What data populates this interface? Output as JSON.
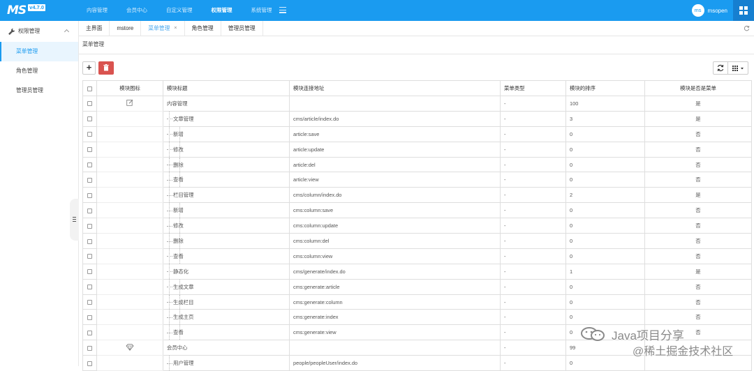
{
  "app": {
    "logo": "MS",
    "version": "v4.7.0"
  },
  "topnav": [
    "内容管理",
    "会员中心",
    "自定义管理",
    "权限管理",
    "系统管理"
  ],
  "topnav_active_index": 3,
  "user": {
    "avatar_text": "ms",
    "name": "msopen"
  },
  "colors": {
    "brand": "#1a9bf0",
    "danger": "#d9534f",
    "link": "#4a86c5"
  },
  "sidebar": {
    "group": "权限管理",
    "items": [
      "菜单管理",
      "角色管理",
      "管理员管理"
    ],
    "active_index": 0
  },
  "tabs": [
    {
      "label": "主界面"
    },
    {
      "label": "mstore"
    },
    {
      "label": "菜单管理",
      "close": "×"
    },
    {
      "label": "角色管理"
    },
    {
      "label": "管理员管理"
    }
  ],
  "breadcrumb": "菜单管理",
  "toolbar": {
    "add_label": "+"
  },
  "table": {
    "headers": [
      "模块图标",
      "模块标题",
      "模块连接地址",
      "菜单类型",
      "模块的排序",
      "模块是否是菜单"
    ],
    "rows": [
      {
        "level": 1,
        "icon": "edit-icon",
        "title": "内容管理",
        "url": "",
        "type": "-",
        "sort": "100",
        "is_menu": "是"
      },
      {
        "level": 2,
        "icon": "",
        "title": "文章管理",
        "url": "cms/article/index.do",
        "type": "-",
        "sort": "3",
        "is_menu": "是"
      },
      {
        "level": 3,
        "icon": "",
        "title": "新增",
        "url": "article:save",
        "type": "-",
        "sort": "0",
        "is_menu": "否"
      },
      {
        "level": 3,
        "icon": "",
        "title": "修改",
        "url": "article:update",
        "type": "-",
        "sort": "0",
        "is_menu": "否"
      },
      {
        "level": 3,
        "icon": "",
        "title": "删除",
        "url": "article:del",
        "type": "-",
        "sort": "0",
        "is_menu": "否"
      },
      {
        "level": 3,
        "icon": "",
        "title": "查看",
        "url": "article:view",
        "type": "-",
        "sort": "0",
        "is_menu": "否"
      },
      {
        "level": 2,
        "icon": "",
        "title": "栏目管理",
        "url": "cms/column/index.do",
        "type": "-",
        "sort": "2",
        "is_menu": "是"
      },
      {
        "level": 3,
        "icon": "",
        "title": "新增",
        "url": "cms:column:save",
        "type": "-",
        "sort": "0",
        "is_menu": "否"
      },
      {
        "level": 3,
        "icon": "",
        "title": "修改",
        "url": "cms:column:update",
        "type": "-",
        "sort": "0",
        "is_menu": "否"
      },
      {
        "level": 3,
        "icon": "",
        "title": "删除",
        "url": "cms:column:del",
        "type": "-",
        "sort": "0",
        "is_menu": "否"
      },
      {
        "level": 3,
        "icon": "",
        "title": "查看",
        "url": "cms:column:view",
        "type": "-",
        "sort": "0",
        "is_menu": "否"
      },
      {
        "level": 2,
        "icon": "",
        "title": "静态化",
        "url": "cms/generate/index.do",
        "type": "-",
        "sort": "1",
        "is_menu": "是"
      },
      {
        "level": 3,
        "icon": "",
        "title": "生成文章",
        "url": "cms:generate:article",
        "type": "-",
        "sort": "0",
        "is_menu": "否"
      },
      {
        "level": 3,
        "icon": "",
        "title": "生成栏目",
        "url": "cms:generate:column",
        "type": "-",
        "sort": "0",
        "is_menu": "否"
      },
      {
        "level": 3,
        "icon": "",
        "title": "生成主页",
        "url": "cms:generate:index",
        "type": "-",
        "sort": "0",
        "is_menu": "否"
      },
      {
        "level": 3,
        "icon": "",
        "title": "查看",
        "url": "cms:generate:view",
        "type": "-",
        "sort": "0",
        "is_menu": "否"
      },
      {
        "level": 1,
        "icon": "diamond-icon",
        "title": "会员中心",
        "url": "",
        "type": "-",
        "sort": "99",
        "is_menu": ""
      },
      {
        "level": 2,
        "icon": "",
        "title": "用户管理",
        "url": "people/peopleUser/index.do",
        "type": "-",
        "sort": "0",
        "is_menu": ""
      }
    ]
  },
  "watermark": {
    "line1": "Java项目分享",
    "line2": "@稀土掘金技术社区"
  }
}
